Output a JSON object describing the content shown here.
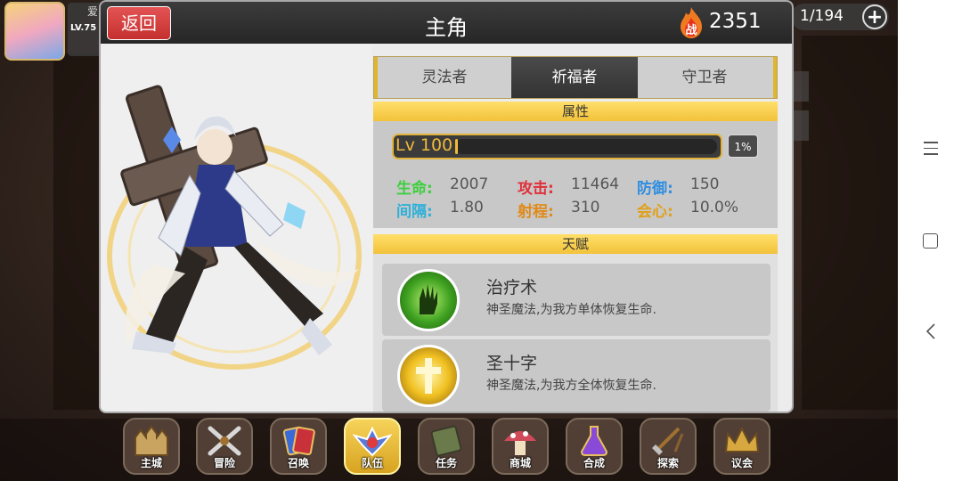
{
  "player": {
    "name": "爱",
    "level": "LV.75"
  },
  "counter": {
    "value": "1/194",
    "add_icon": "plus-icon"
  },
  "panel": {
    "back_label": "返回",
    "title": "主角",
    "power_icon": "flame-power-icon",
    "power_icon_char": "战",
    "power": "2351"
  },
  "tabs": [
    {
      "label": "灵法者",
      "active": false
    },
    {
      "label": "祈福者",
      "active": true
    },
    {
      "label": "守卫者",
      "active": false
    }
  ],
  "attributes": {
    "header": "属性",
    "level_label": "Lv 100",
    "exp_percent_label": "1%",
    "exp_fraction": 0.01,
    "stats": [
      {
        "label": "生命:",
        "value": "2007",
        "color": "#3ccf3c"
      },
      {
        "label": "攻击:",
        "value": "11464",
        "color": "#e0303a"
      },
      {
        "label": "防御:",
        "value": "150",
        "color": "#2f8ee0"
      },
      {
        "label": "间隔:",
        "value": "1.80",
        "color": "#2fb0d8"
      },
      {
        "label": "射程:",
        "value": "310",
        "color": "#e08a18"
      },
      {
        "label": "会心:",
        "value": "10.0%",
        "color": "#e0a018"
      }
    ]
  },
  "talents": {
    "header": "天赋",
    "items": [
      {
        "name": "治疗术",
        "desc": "神圣魔法,为我方单体恢复生命.",
        "icon": "healing-hand-icon"
      },
      {
        "name": "圣十字",
        "desc": "神圣魔法,为我方全体恢复生命.",
        "icon": "holy-cross-icon"
      }
    ]
  },
  "bottom_nav": [
    {
      "label": "主城",
      "icon": "castle-icon",
      "active": false
    },
    {
      "label": "冒险",
      "icon": "crossed-swords-icon",
      "active": false
    },
    {
      "label": "召唤",
      "icon": "summon-cards-icon",
      "active": false
    },
    {
      "label": "队伍",
      "icon": "team-emblem-icon",
      "active": true
    },
    {
      "label": "任务",
      "icon": "quest-book-icon",
      "active": false
    },
    {
      "label": "商城",
      "icon": "mushroom-shop-icon",
      "active": false
    },
    {
      "label": "合成",
      "icon": "potion-flask-icon",
      "active": false
    },
    {
      "label": "探索",
      "icon": "explore-shovel-icon",
      "active": false
    },
    {
      "label": "议会",
      "icon": "council-crown-icon",
      "active": false
    }
  ],
  "system_nav": {
    "menu_icon": "menu-icon",
    "home_icon": "home-square-icon",
    "back_icon": "back-chevron-icon"
  }
}
